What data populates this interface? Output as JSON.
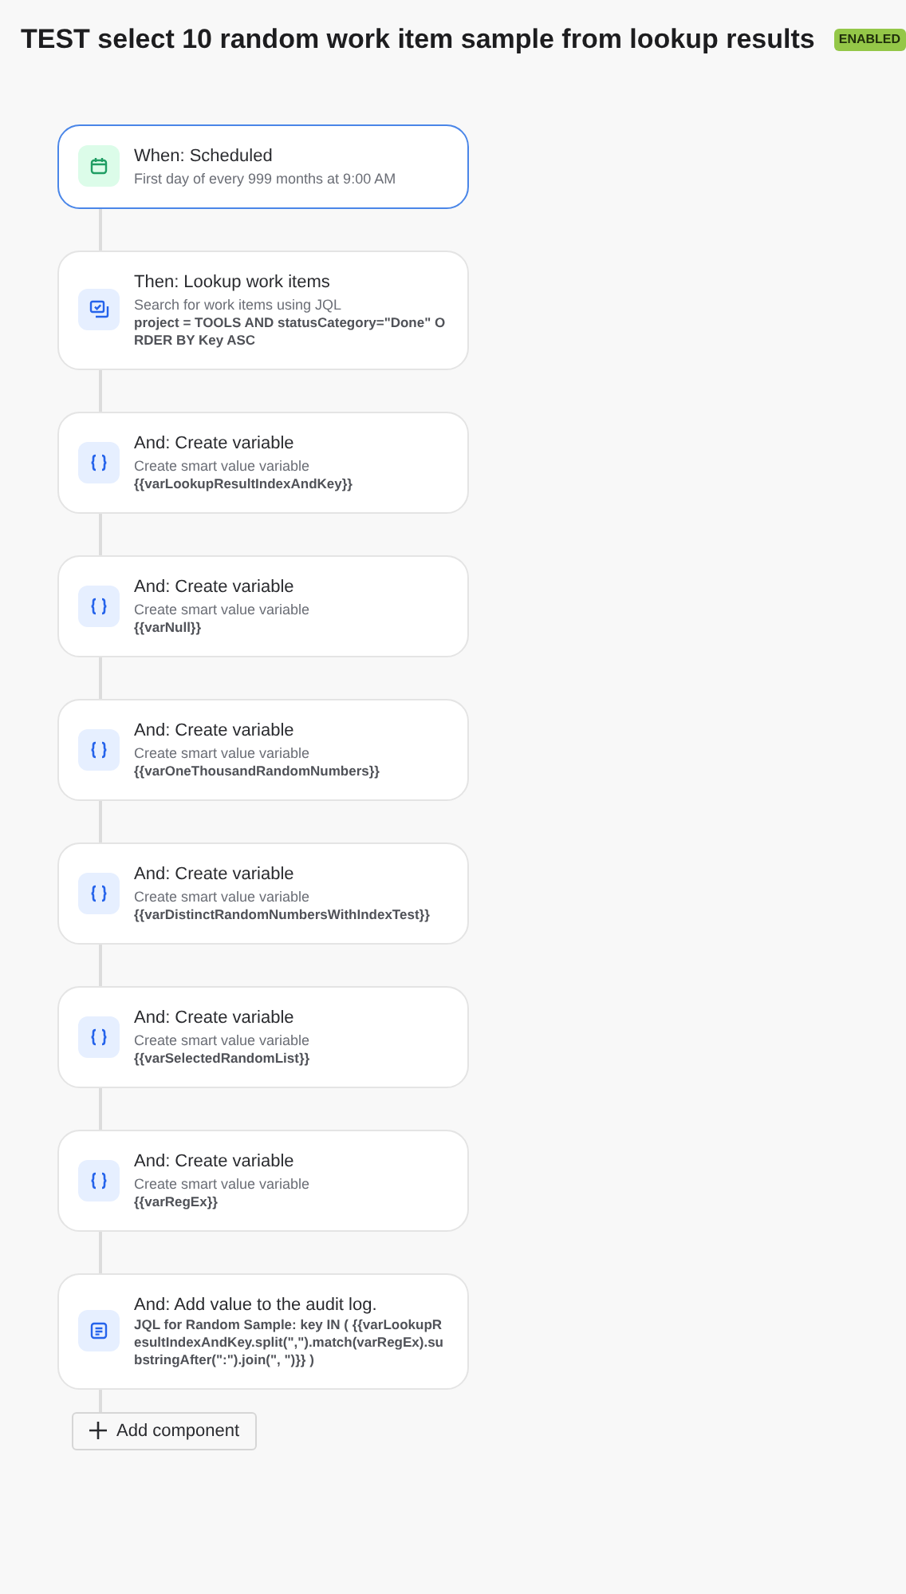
{
  "title": "TEST select 10 random work item sample from lookup results",
  "status_badge": "ENABLED",
  "steps": [
    {
      "kind": "trigger",
      "selected": true,
      "title": "When: Scheduled",
      "description": "First day of every 999 months at 9:00 AM"
    },
    {
      "kind": "lookup",
      "selected": false,
      "title": "Then: Lookup work items",
      "description": "Search for work items using JQL",
      "detail": "project = TOOLS AND statusCategory=\"Done\" ORDER BY Key ASC"
    },
    {
      "kind": "variable",
      "selected": false,
      "title": "And: Create variable",
      "description": "Create smart value variable",
      "detail": "{{varLookupResultIndexAndKey}}"
    },
    {
      "kind": "variable",
      "selected": false,
      "title": "And: Create variable",
      "description": "Create smart value variable",
      "detail": "{{varNull}}"
    },
    {
      "kind": "variable",
      "selected": false,
      "title": "And: Create variable",
      "description": "Create smart value variable",
      "detail": "{{varOneThousandRandomNumbers}}"
    },
    {
      "kind": "variable",
      "selected": false,
      "title": "And: Create variable",
      "description": "Create smart value variable",
      "detail": "{{varDistinctRandomNumbersWithIndexTest}}"
    },
    {
      "kind": "variable",
      "selected": false,
      "title": "And: Create variable",
      "description": "Create smart value variable",
      "detail": "{{varSelectedRandomList}}"
    },
    {
      "kind": "variable",
      "selected": false,
      "title": "And: Create variable",
      "description": "Create smart value variable",
      "detail": "{{varRegEx}}"
    },
    {
      "kind": "log",
      "selected": false,
      "title": "And: Add value to the audit log.",
      "detail": "JQL for Random Sample: key IN ( {{varLookupResultIndexAndKey.split(\",\").match(varRegEx).substringAfter(\":\").join(\", \")}} )"
    }
  ],
  "add_button": "Add component"
}
